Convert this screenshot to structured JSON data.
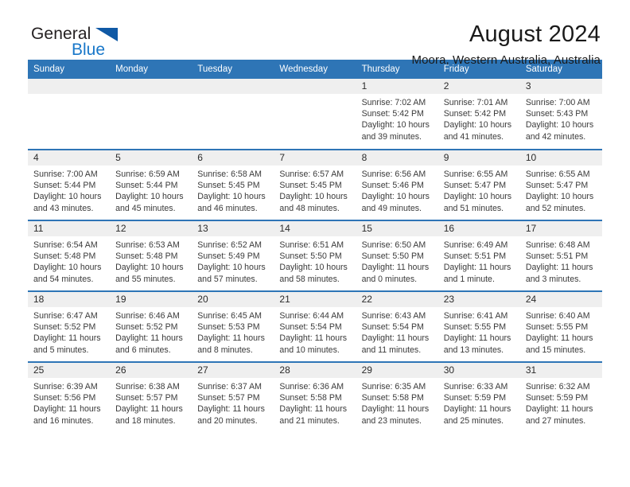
{
  "brand": {
    "name_part1": "General",
    "name_part2": "Blue",
    "flag_color": "#1059a5",
    "blue_color": "#1877c9"
  },
  "header": {
    "title": "August 2024",
    "subtitle": "Moora, Western Australia, Australia"
  },
  "colors": {
    "header_bar": "#2e75b6",
    "daynum_band": "#efefef"
  },
  "weekday_headers": [
    "Sunday",
    "Monday",
    "Tuesday",
    "Wednesday",
    "Thursday",
    "Friday",
    "Saturday"
  ],
  "labels": {
    "sunrise_prefix": "Sunrise:",
    "sunset_prefix": "Sunset:",
    "daylight_prefix": "Daylight:"
  },
  "weeks": [
    [
      {
        "day": "",
        "empty": true
      },
      {
        "day": "",
        "empty": true
      },
      {
        "day": "",
        "empty": true
      },
      {
        "day": "",
        "empty": true
      },
      {
        "day": "1",
        "sunrise": "Sunrise: 7:02 AM",
        "sunset": "Sunset: 5:42 PM",
        "daylight_line1": "Daylight: 10 hours",
        "daylight_line2": "and 39 minutes."
      },
      {
        "day": "2",
        "sunrise": "Sunrise: 7:01 AM",
        "sunset": "Sunset: 5:42 PM",
        "daylight_line1": "Daylight: 10 hours",
        "daylight_line2": "and 41 minutes."
      },
      {
        "day": "3",
        "sunrise": "Sunrise: 7:00 AM",
        "sunset": "Sunset: 5:43 PM",
        "daylight_line1": "Daylight: 10 hours",
        "daylight_line2": "and 42 minutes."
      }
    ],
    [
      {
        "day": "4",
        "sunrise": "Sunrise: 7:00 AM",
        "sunset": "Sunset: 5:44 PM",
        "daylight_line1": "Daylight: 10 hours",
        "daylight_line2": "and 43 minutes."
      },
      {
        "day": "5",
        "sunrise": "Sunrise: 6:59 AM",
        "sunset": "Sunset: 5:44 PM",
        "daylight_line1": "Daylight: 10 hours",
        "daylight_line2": "and 45 minutes."
      },
      {
        "day": "6",
        "sunrise": "Sunrise: 6:58 AM",
        "sunset": "Sunset: 5:45 PM",
        "daylight_line1": "Daylight: 10 hours",
        "daylight_line2": "and 46 minutes."
      },
      {
        "day": "7",
        "sunrise": "Sunrise: 6:57 AM",
        "sunset": "Sunset: 5:45 PM",
        "daylight_line1": "Daylight: 10 hours",
        "daylight_line2": "and 48 minutes."
      },
      {
        "day": "8",
        "sunrise": "Sunrise: 6:56 AM",
        "sunset": "Sunset: 5:46 PM",
        "daylight_line1": "Daylight: 10 hours",
        "daylight_line2": "and 49 minutes."
      },
      {
        "day": "9",
        "sunrise": "Sunrise: 6:55 AM",
        "sunset": "Sunset: 5:47 PM",
        "daylight_line1": "Daylight: 10 hours",
        "daylight_line2": "and 51 minutes."
      },
      {
        "day": "10",
        "sunrise": "Sunrise: 6:55 AM",
        "sunset": "Sunset: 5:47 PM",
        "daylight_line1": "Daylight: 10 hours",
        "daylight_line2": "and 52 minutes."
      }
    ],
    [
      {
        "day": "11",
        "sunrise": "Sunrise: 6:54 AM",
        "sunset": "Sunset: 5:48 PM",
        "daylight_line1": "Daylight: 10 hours",
        "daylight_line2": "and 54 minutes."
      },
      {
        "day": "12",
        "sunrise": "Sunrise: 6:53 AM",
        "sunset": "Sunset: 5:48 PM",
        "daylight_line1": "Daylight: 10 hours",
        "daylight_line2": "and 55 minutes."
      },
      {
        "day": "13",
        "sunrise": "Sunrise: 6:52 AM",
        "sunset": "Sunset: 5:49 PM",
        "daylight_line1": "Daylight: 10 hours",
        "daylight_line2": "and 57 minutes."
      },
      {
        "day": "14",
        "sunrise": "Sunrise: 6:51 AM",
        "sunset": "Sunset: 5:50 PM",
        "daylight_line1": "Daylight: 10 hours",
        "daylight_line2": "and 58 minutes."
      },
      {
        "day": "15",
        "sunrise": "Sunrise: 6:50 AM",
        "sunset": "Sunset: 5:50 PM",
        "daylight_line1": "Daylight: 11 hours",
        "daylight_line2": "and 0 minutes."
      },
      {
        "day": "16",
        "sunrise": "Sunrise: 6:49 AM",
        "sunset": "Sunset: 5:51 PM",
        "daylight_line1": "Daylight: 11 hours",
        "daylight_line2": "and 1 minute."
      },
      {
        "day": "17",
        "sunrise": "Sunrise: 6:48 AM",
        "sunset": "Sunset: 5:51 PM",
        "daylight_line1": "Daylight: 11 hours",
        "daylight_line2": "and 3 minutes."
      }
    ],
    [
      {
        "day": "18",
        "sunrise": "Sunrise: 6:47 AM",
        "sunset": "Sunset: 5:52 PM",
        "daylight_line1": "Daylight: 11 hours",
        "daylight_line2": "and 5 minutes."
      },
      {
        "day": "19",
        "sunrise": "Sunrise: 6:46 AM",
        "sunset": "Sunset: 5:52 PM",
        "daylight_line1": "Daylight: 11 hours",
        "daylight_line2": "and 6 minutes."
      },
      {
        "day": "20",
        "sunrise": "Sunrise: 6:45 AM",
        "sunset": "Sunset: 5:53 PM",
        "daylight_line1": "Daylight: 11 hours",
        "daylight_line2": "and 8 minutes."
      },
      {
        "day": "21",
        "sunrise": "Sunrise: 6:44 AM",
        "sunset": "Sunset: 5:54 PM",
        "daylight_line1": "Daylight: 11 hours",
        "daylight_line2": "and 10 minutes."
      },
      {
        "day": "22",
        "sunrise": "Sunrise: 6:43 AM",
        "sunset": "Sunset: 5:54 PM",
        "daylight_line1": "Daylight: 11 hours",
        "daylight_line2": "and 11 minutes."
      },
      {
        "day": "23",
        "sunrise": "Sunrise: 6:41 AM",
        "sunset": "Sunset: 5:55 PM",
        "daylight_line1": "Daylight: 11 hours",
        "daylight_line2": "and 13 minutes."
      },
      {
        "day": "24",
        "sunrise": "Sunrise: 6:40 AM",
        "sunset": "Sunset: 5:55 PM",
        "daylight_line1": "Daylight: 11 hours",
        "daylight_line2": "and 15 minutes."
      }
    ],
    [
      {
        "day": "25",
        "sunrise": "Sunrise: 6:39 AM",
        "sunset": "Sunset: 5:56 PM",
        "daylight_line1": "Daylight: 11 hours",
        "daylight_line2": "and 16 minutes."
      },
      {
        "day": "26",
        "sunrise": "Sunrise: 6:38 AM",
        "sunset": "Sunset: 5:57 PM",
        "daylight_line1": "Daylight: 11 hours",
        "daylight_line2": "and 18 minutes."
      },
      {
        "day": "27",
        "sunrise": "Sunrise: 6:37 AM",
        "sunset": "Sunset: 5:57 PM",
        "daylight_line1": "Daylight: 11 hours",
        "daylight_line2": "and 20 minutes."
      },
      {
        "day": "28",
        "sunrise": "Sunrise: 6:36 AM",
        "sunset": "Sunset: 5:58 PM",
        "daylight_line1": "Daylight: 11 hours",
        "daylight_line2": "and 21 minutes."
      },
      {
        "day": "29",
        "sunrise": "Sunrise: 6:35 AM",
        "sunset": "Sunset: 5:58 PM",
        "daylight_line1": "Daylight: 11 hours",
        "daylight_line2": "and 23 minutes."
      },
      {
        "day": "30",
        "sunrise": "Sunrise: 6:33 AM",
        "sunset": "Sunset: 5:59 PM",
        "daylight_line1": "Daylight: 11 hours",
        "daylight_line2": "and 25 minutes."
      },
      {
        "day": "31",
        "sunrise": "Sunrise: 6:32 AM",
        "sunset": "Sunset: 5:59 PM",
        "daylight_line1": "Daylight: 11 hours",
        "daylight_line2": "and 27 minutes."
      }
    ]
  ]
}
